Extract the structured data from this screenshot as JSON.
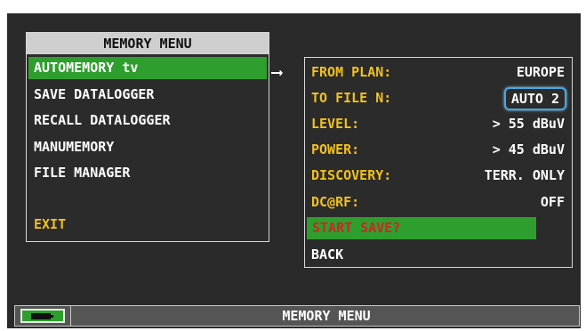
{
  "memory_menu": {
    "title": "MEMORY MENU",
    "items": [
      {
        "label": "AUTOMEMORY tv",
        "selected": true
      },
      {
        "label": "SAVE DATALOGGER"
      },
      {
        "label": "RECALL DATALOGGER"
      },
      {
        "label": "MANUMEMORY"
      },
      {
        "label": "FILE MANAGER"
      },
      {
        "label": "EXIT"
      }
    ]
  },
  "automemory": {
    "rows": [
      {
        "label": "FROM PLAN:",
        "value": "EUROPE"
      },
      {
        "label": "TO FILE N:",
        "value": "AUTO 2"
      },
      {
        "label": "LEVEL:",
        "value": "> 55 dBuV"
      },
      {
        "label": "POWER:",
        "value": "> 45 dBuV"
      },
      {
        "label": "DISCOVERY:",
        "value": "TERR. ONLY"
      },
      {
        "label": "DC@RF:",
        "value": "OFF"
      }
    ],
    "start_save": "START SAVE?",
    "back": "BACK"
  },
  "status_bar": {
    "title": "MEMORY MENU",
    "battery_icon": "battery-charging-icon"
  },
  "colors": {
    "selected_bg": "#2e9e2e",
    "label_yellow": "#f0c020",
    "start_save_red": "#d22424",
    "highlight_blue": "#4aa8e0"
  }
}
